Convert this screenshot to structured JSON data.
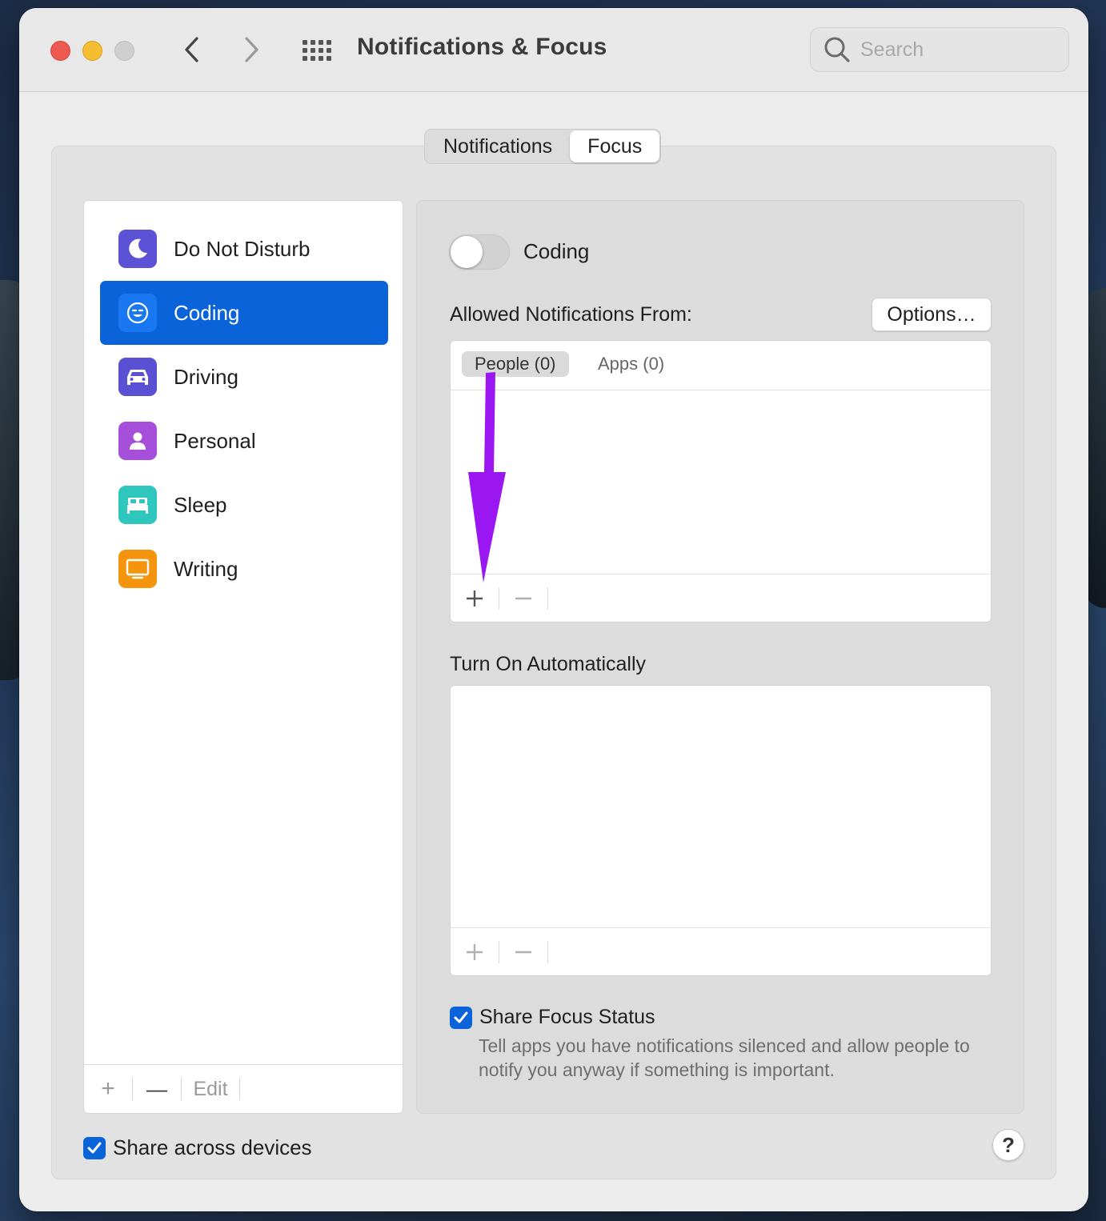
{
  "window": {
    "title": "Notifications & Focus"
  },
  "search": {
    "placeholder": "Search"
  },
  "tabs": [
    {
      "label": "Notifications",
      "selected": false
    },
    {
      "label": "Focus",
      "selected": true
    }
  ],
  "focus_list": {
    "items": [
      {
        "label": "Do Not Disturb",
        "icon": "moon-icon",
        "color": "#5b52d6",
        "selected": false
      },
      {
        "label": "Coding",
        "icon": "smiley-icon",
        "color": "#1977f2",
        "selected": true
      },
      {
        "label": "Driving",
        "icon": "car-icon",
        "color": "#5a50d4",
        "selected": false
      },
      {
        "label": "Personal",
        "icon": "person-icon",
        "color": "#a64fdb",
        "selected": false
      },
      {
        "label": "Sleep",
        "icon": "bed-icon",
        "color": "#2fc6be",
        "selected": false
      },
      {
        "label": "Writing",
        "icon": "monitor-icon",
        "color": "#f5950e",
        "selected": false
      }
    ],
    "footer": {
      "add": "+",
      "remove": "—",
      "edit": "Edit"
    }
  },
  "detail": {
    "toggle_label": "Coding",
    "toggle_on": false,
    "allowed_label": "Allowed Notifications From:",
    "options_button": "Options…",
    "allowed_tabs": [
      {
        "label": "People (0)",
        "selected": true
      },
      {
        "label": "Apps (0)",
        "selected": false
      }
    ],
    "auto_label": "Turn On Automatically",
    "share_focus": {
      "label": "Share Focus Status",
      "checked": true,
      "description": "Tell apps you have notifications silenced and allow people to notify you anyway if something is important."
    }
  },
  "share_devices": {
    "label": "Share across devices",
    "checked": true
  },
  "help": "?",
  "annotation_color": "#9b17f2",
  "accent_color": "#0a63d8"
}
